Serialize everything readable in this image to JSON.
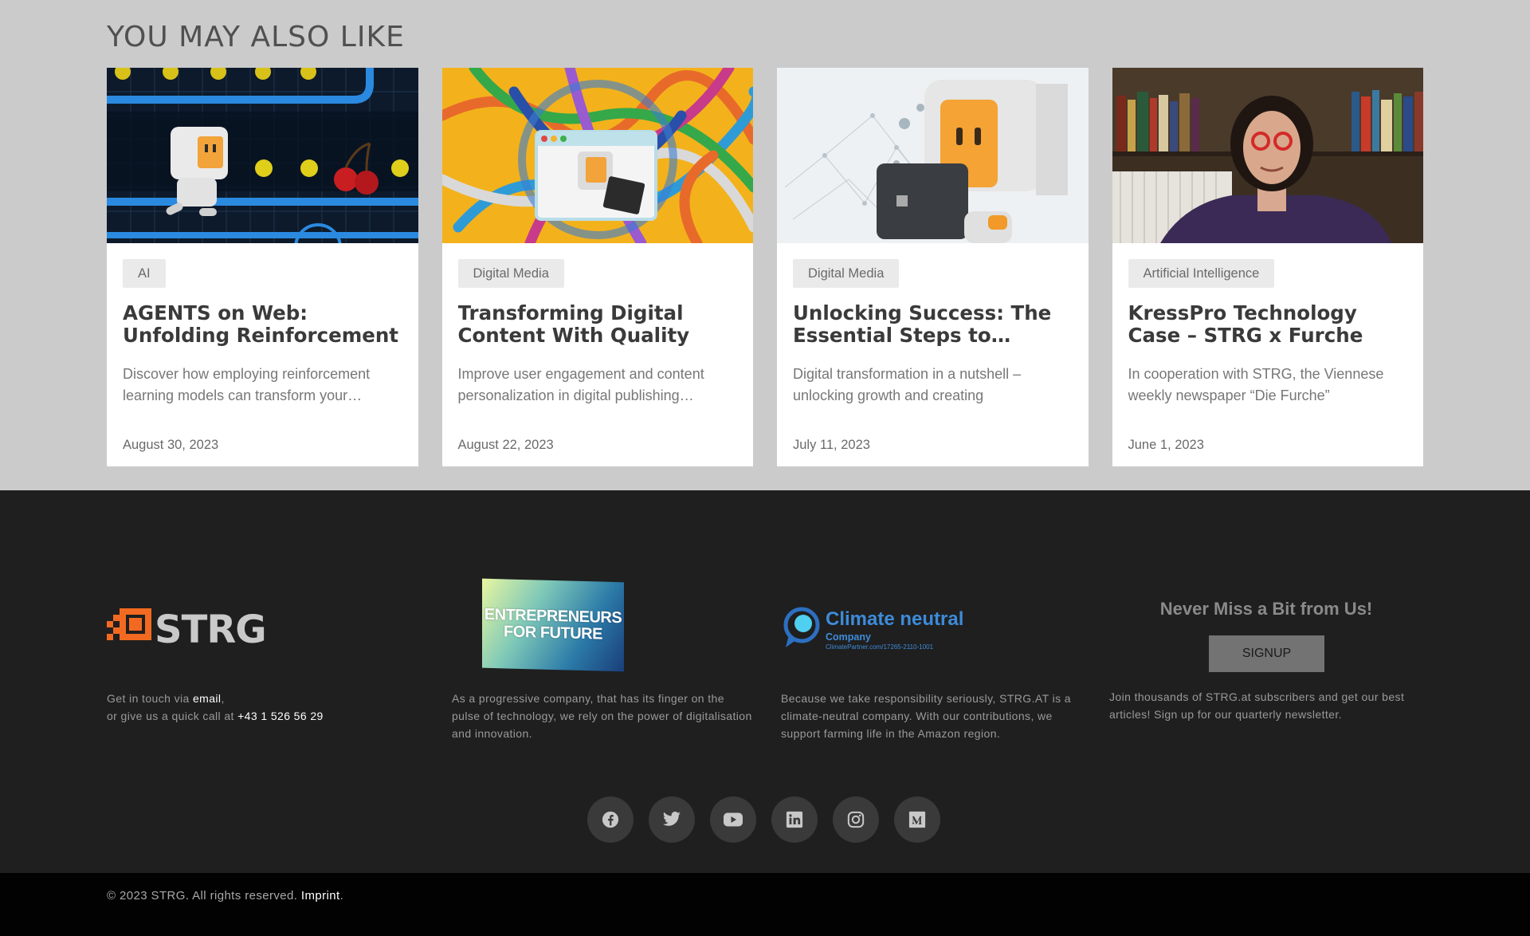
{
  "related": {
    "heading": "YOU MAY ALSO LIKE",
    "cards": [
      {
        "category": "AI",
        "title": "AGENTS on Web: Unfolding Reinforcement Learning",
        "excerpt": "Discover how employing reinforcement learning models can transform your…",
        "date": "August 30, 2023",
        "image": "robot-pacman-illustration"
      },
      {
        "category": "Digital Media",
        "title": "Transforming Digital Content With Quality Dat…",
        "excerpt": "Improve user engagement and content personalization in digital publishing…",
        "date": "August 22, 2023",
        "image": "tangled-cables-robot-illustration"
      },
      {
        "category": "Digital Media",
        "title": "Unlocking Success: The Essential Steps to…",
        "excerpt": "Digital transformation in a nutshell – unlocking growth and creating",
        "date": "July 11, 2023",
        "image": "robot-laptop-network-illustration"
      },
      {
        "category": "Artificial Intelligence",
        "title": "KressPro Technology Case – STRG x Furche show how …",
        "excerpt": "In cooperation with STRG, the Viennese weekly newspaper “Die Furche”",
        "date": "June 1, 2023",
        "image": "portrait-bookshelf-photo"
      }
    ]
  },
  "footer": {
    "logo_text": "STRG.",
    "contact": {
      "prefix": "Get in touch via ",
      "email_link": "email",
      "comma": ",",
      "line2_prefix": "or give us a quick call at ",
      "phone": "+43 1 526 56 29"
    },
    "entrepreneurs": {
      "badge_line1": "ENTREPRENEURS",
      "badge_line2": "FOR FUTURE",
      "text": "As a progressive company, that has its finger on the pulse of technology, we rely on the power of digitalisation and innovation."
    },
    "climate": {
      "title": "Climate neutral",
      "sub": "Company",
      "url": "ClimatePartner.com/17265-2110-1001",
      "text": "Because we take responsibility seriously, STRG.AT is a climate-neutral company. With our contributions, we support farming life in the Amazon region."
    },
    "newsletter": {
      "title": "Never Miss a Bit from Us!",
      "button": "SIGNUP",
      "text": "Join thousands of STRG.at subscribers and get our best articles! Sign up for our quarterly newsletter."
    },
    "socials": [
      "facebook-icon",
      "twitter-icon",
      "youtube-icon",
      "linkedin-icon",
      "instagram-icon",
      "medium-icon"
    ]
  },
  "bottom": {
    "copyright": "© 2023 STRG. All rights reserved. ",
    "imprint": "Imprint",
    "dot": "."
  },
  "colors": {
    "accent_orange": "#f26a21",
    "logo_grey": "#c9c9c9",
    "footer_bg": "#1f1f1f",
    "climate_blue": "#3d8bd9"
  }
}
